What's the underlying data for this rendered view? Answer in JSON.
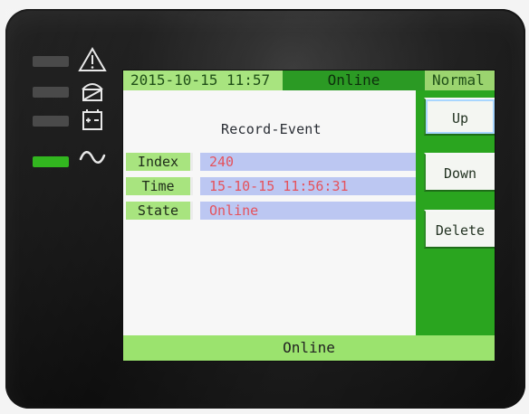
{
  "screen": {
    "header": {
      "date_time": "2015-10-15 11:57",
      "status": "Online",
      "mode": "Normal"
    },
    "title": "Record-Event",
    "fields": [
      {
        "label": "Index",
        "value": "240"
      },
      {
        "label": "Time",
        "value": "15-10-15 11:56:31"
      },
      {
        "label": "State",
        "value": "Online"
      }
    ],
    "buttons": {
      "up": "Up",
      "down": "Down",
      "delete": "Delete"
    },
    "footer_status": "Online"
  },
  "indicators": [
    {
      "icon": "warning-icon",
      "active": false
    },
    {
      "icon": "bypass-icon",
      "active": false
    },
    {
      "icon": "battery-icon",
      "active": false
    },
    {
      "icon": "ac-wave-icon",
      "active": true
    }
  ],
  "colors": {
    "green_primary": "#2aa51f",
    "green_light": "#a8e47f",
    "value_bg": "#bcc7f2",
    "value_text": "#e5525c",
    "indicator_active": "#32b61f",
    "indicator_idle": "#4a4a4a"
  }
}
